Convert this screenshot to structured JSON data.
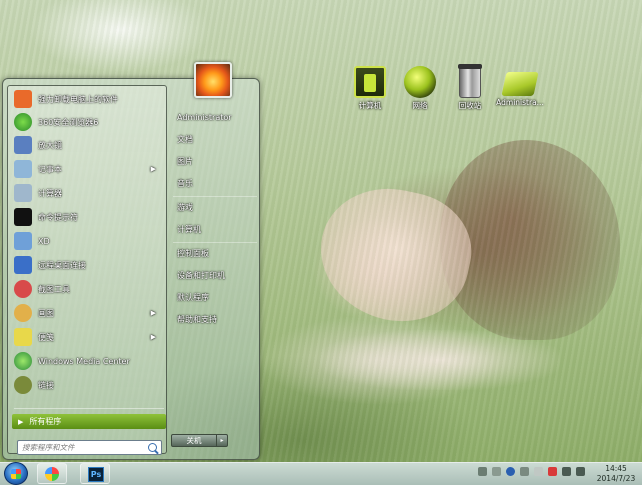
{
  "desktop": {
    "icons": [
      {
        "label": "计算机",
        "icon": "computer-icon"
      },
      {
        "label": "网络",
        "icon": "network-icon"
      },
      {
        "label": "回收站",
        "icon": "recycle-bin-icon"
      },
      {
        "label": "Administra...",
        "icon": "user-folder-icon"
      }
    ]
  },
  "start_menu": {
    "programs": [
      {
        "label": "强力卸载电脑上的软件",
        "icon": "uninstall-icon",
        "has_submenu": false,
        "color": "#e96a2a"
      },
      {
        "label": "360安全浏览器6",
        "icon": "browser-360-icon",
        "has_submenu": false,
        "color": "#3aa83a"
      },
      {
        "label": "放大镜",
        "icon": "magnifier-icon",
        "has_submenu": false,
        "color": "#5a7fc0"
      },
      {
        "label": "记事本",
        "icon": "notepad-icon",
        "has_submenu": true,
        "color": "#8fb6d8"
      },
      {
        "label": "计算器",
        "icon": "calculator-icon",
        "has_submenu": false,
        "color": "#9fb7cc"
      },
      {
        "label": "命令提示符",
        "icon": "cmd-icon",
        "has_submenu": false,
        "color": "#111111"
      },
      {
        "label": "XD",
        "icon": "xd-icon",
        "has_submenu": false,
        "color": "#6fa0d8"
      },
      {
        "label": "远程桌面连接",
        "icon": "remote-desktop-icon",
        "has_submenu": false,
        "color": "#3a6fc8"
      },
      {
        "label": "截图工具",
        "icon": "snipping-tool-icon",
        "has_submenu": false,
        "color": "#d84a4a"
      },
      {
        "label": "画图",
        "icon": "paint-icon",
        "has_submenu": true,
        "color": "#e2b04a"
      },
      {
        "label": "便笺",
        "icon": "sticky-notes-icon",
        "has_submenu": true,
        "color": "#e8d84a"
      },
      {
        "label": "Windows Media Center",
        "icon": "media-center-icon",
        "has_submenu": false,
        "color": "#3aa84a"
      },
      {
        "label": "链接",
        "icon": "links-icon",
        "has_submenu": false,
        "color": "#7a8a3a"
      }
    ],
    "all_programs_label": "所有程序",
    "search": {
      "placeholder": "搜索程序和文件"
    },
    "right_items": [
      {
        "label": "Administrator"
      },
      {
        "label": "文档"
      },
      {
        "label": "图片"
      },
      {
        "label": "音乐"
      },
      {
        "label": "游戏"
      },
      {
        "label": "计算机"
      },
      {
        "label": "控制面板"
      },
      {
        "label": "设备和打印机"
      },
      {
        "label": "默认程序"
      },
      {
        "label": "帮助和支持"
      }
    ],
    "shutdown_label": "关机",
    "shutdown_arrow": "▸"
  },
  "taskbar": {
    "pinned": [
      {
        "icon": "browser-icon"
      },
      {
        "icon": "photoshop-icon",
        "label": "Ps"
      }
    ],
    "clock": {
      "time": "14:45",
      "date": "2014/7/23"
    }
  },
  "colors": {
    "accent": "#6ca420",
    "all_programs_bar": "#7aaa2a"
  }
}
